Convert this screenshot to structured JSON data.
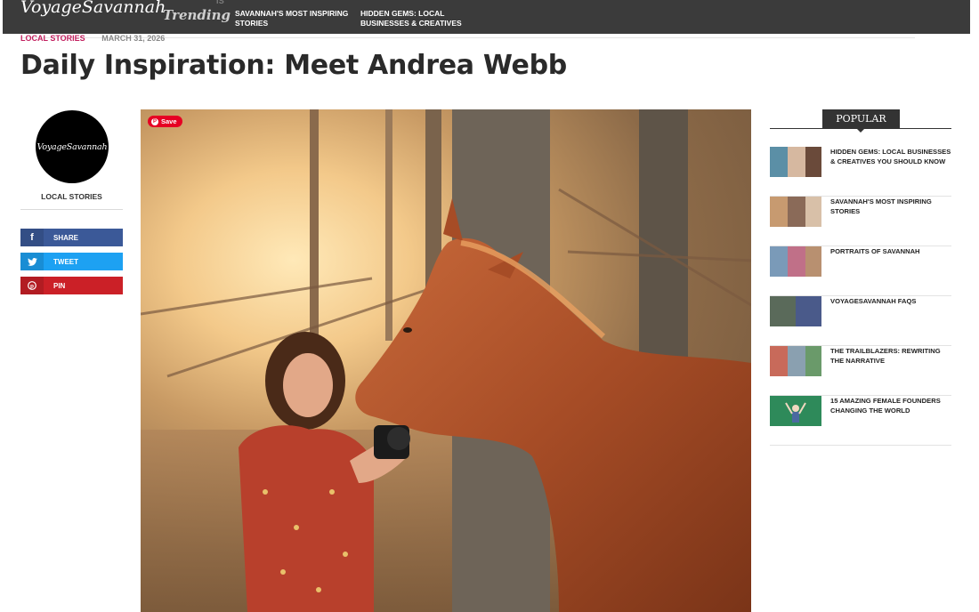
{
  "site": {
    "logo": "VoyageSavannah"
  },
  "topbar": {
    "trending_label": "Trending",
    "links": [
      "SAVANNAH'S MOST INSPIRING STORIES",
      "HIDDEN GEMS: LOCAL BUSINESSES & CREATIVES"
    ]
  },
  "article": {
    "category": "LOCAL STORIES",
    "date": "MARCH 31, 2026",
    "title": "Daily Inspiration: Meet Andrea Webb",
    "hero_save_label": "Save"
  },
  "author": {
    "avatar_text": "VoyageSavannah",
    "category": "LOCAL STORIES"
  },
  "share": {
    "facebook": "SHARE",
    "twitter": "TWEET",
    "pinterest": "PIN"
  },
  "sidebar": {
    "heading": "POPULAR",
    "items": [
      {
        "title": "HIDDEN GEMS: LOCAL BUSINESSES & CREATIVES YOU SHOULD KNOW"
      },
      {
        "title": "SAVANNAH'S MOST INSPIRING STORIES"
      },
      {
        "title": "PORTRAITS OF SAVANNAH"
      },
      {
        "title": "VOYAGESAVANNAH FAQS"
      },
      {
        "title": "THE TRAILBLAZERS: REWRITING THE NARRATIVE"
      },
      {
        "title": "15 AMAZING FEMALE FOUNDERS CHANGING THE WORLD"
      }
    ]
  },
  "colors": {
    "topbar": "#3b3b3b",
    "category_accent": "#c21e5e",
    "facebook": "#3b5998",
    "twitter": "#1da1f2",
    "pinterest": "#cb2027"
  }
}
